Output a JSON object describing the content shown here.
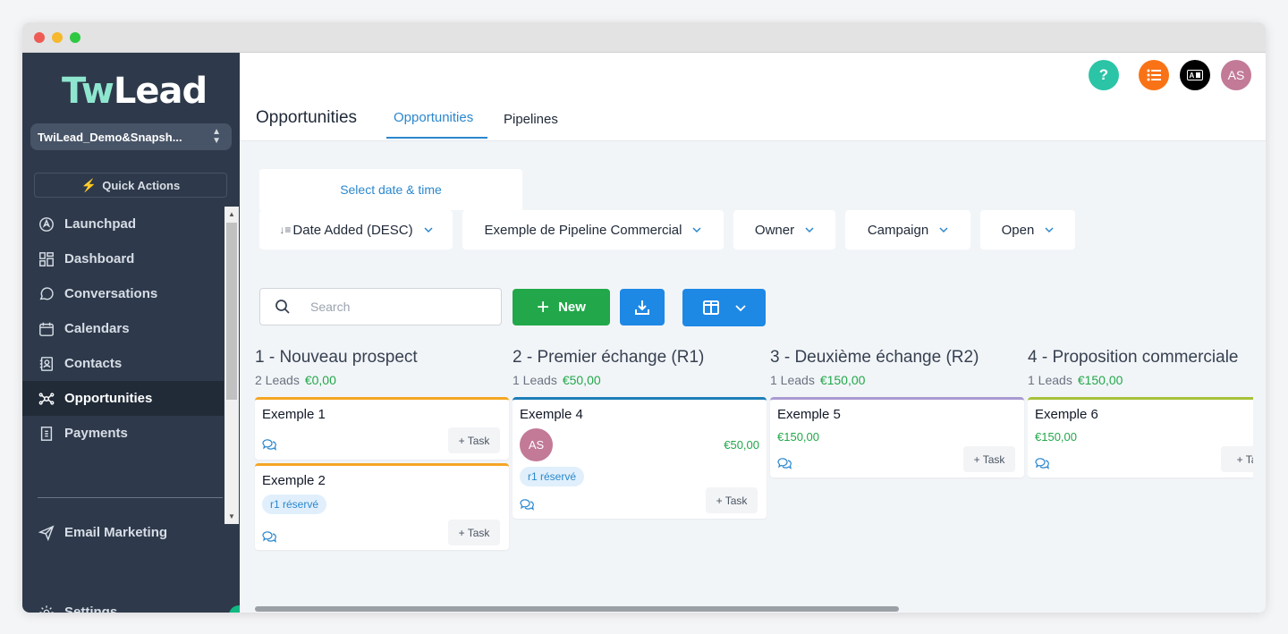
{
  "sidebar": {
    "logo_prefix": "Tw",
    "logo_suffix": "Lead",
    "account": "TwiLead_Demo&Snapsh...",
    "quick_actions": "Quick Actions",
    "items": [
      {
        "label": "Launchpad"
      },
      {
        "label": "Dashboard"
      },
      {
        "label": "Conversations"
      },
      {
        "label": "Calendars"
      },
      {
        "label": "Contacts"
      },
      {
        "label": "Opportunities"
      },
      {
        "label": "Payments"
      }
    ],
    "email_marketing": "Email Marketing",
    "settings": "Settings"
  },
  "header": {
    "page_title": "Opportunities",
    "tabs": [
      {
        "label": "Opportunities"
      },
      {
        "label": "Pipelines"
      }
    ],
    "help": "?",
    "ab": "A■",
    "avatar": "AS"
  },
  "toolbar": {
    "date_picker": "Select date & time",
    "sort": "Date Added (DESC)",
    "pipeline": "Exemple de Pipeline Commercial",
    "owner": "Owner",
    "campaign": "Campaign",
    "status": "Open",
    "search_placeholder": "Search",
    "new_label": "New"
  },
  "columns": [
    {
      "title": "1 - Nouveau prospect",
      "leads": "2 Leads",
      "amount": "€0,00",
      "cards": [
        {
          "title": "Exemple 1",
          "task": "+ Task"
        },
        {
          "title": "Exemple 2",
          "tag": "r1 réservé",
          "task": "+ Task"
        }
      ]
    },
    {
      "title": "2 - Premier échange (R1)",
      "leads": "1 Leads",
      "amount": "€50,00",
      "cards": [
        {
          "title": "Exemple 4",
          "avatar": "AS",
          "amount": "€50,00",
          "tag": "r1 réservé",
          "task": "+ Task"
        }
      ]
    },
    {
      "title": "3 - Deuxième échange (R2)",
      "leads": "1 Leads",
      "amount": "€150,00",
      "cards": [
        {
          "title": "Exemple 5",
          "amount": "€150,00",
          "task": "+ Task"
        }
      ]
    },
    {
      "title": "4 - Proposition commerciale",
      "leads": "1 Leads",
      "amount": "€150,00",
      "cards": [
        {
          "title": "Exemple 6",
          "amount": "€150,00",
          "task": "+ Ta"
        }
      ]
    }
  ],
  "colors": {
    "sidebar_bg": "#2e3a4b",
    "accent_blue": "#2b87cd",
    "new_green": "#22a84a",
    "col1_border": "#f5a623",
    "col2_border": "#1e7fb8",
    "col3_border": "#a99bd3",
    "col4_border": "#a6c13a"
  }
}
